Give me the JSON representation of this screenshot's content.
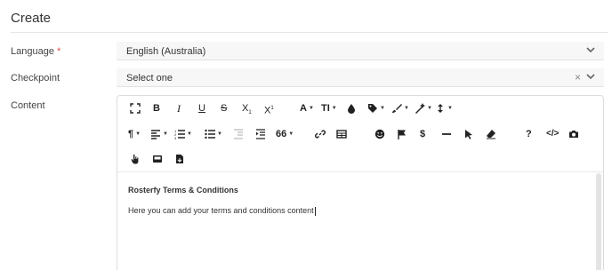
{
  "page": {
    "title": "Create"
  },
  "language": {
    "label": "Language",
    "required_mark": "*",
    "value": "English (Australia)"
  },
  "checkpoint": {
    "label": "Checkpoint",
    "value": "Select one",
    "clear_glyph": "×"
  },
  "content": {
    "label": "Content",
    "heading": "Rosterfy Terms & Conditions",
    "body": "Here you can add your terms and conditions content"
  },
  "toolbar": {
    "bold": "B",
    "italic": "I",
    "underline": "U",
    "strike": "S",
    "subscript": "X",
    "subscript_mark": "1",
    "superscript": "X",
    "superscript_mark": "1",
    "font": "A",
    "font_size": "TI",
    "paragraph": "¶",
    "quote": "66",
    "special_char": "$",
    "help": "?",
    "code": "</>"
  },
  "colors": {
    "required": "#e5484d",
    "input_bg": "#f7f7f7",
    "border": "#dcdcdc"
  },
  "icons": [
    "fullscreen-icon",
    "droplet-icon",
    "tag-icon",
    "brush-icon",
    "magic-icon",
    "line-height-icon",
    "align-icon",
    "ordered-list-icon",
    "unordered-list-icon",
    "outdent-icon",
    "indent-icon",
    "link-icon",
    "table-icon",
    "emoji-icon",
    "flag-icon",
    "horizontal-rule-icon",
    "cursor-icon",
    "eraser-icon",
    "camera-icon",
    "hand-icon",
    "video-icon",
    "file-icon"
  ]
}
